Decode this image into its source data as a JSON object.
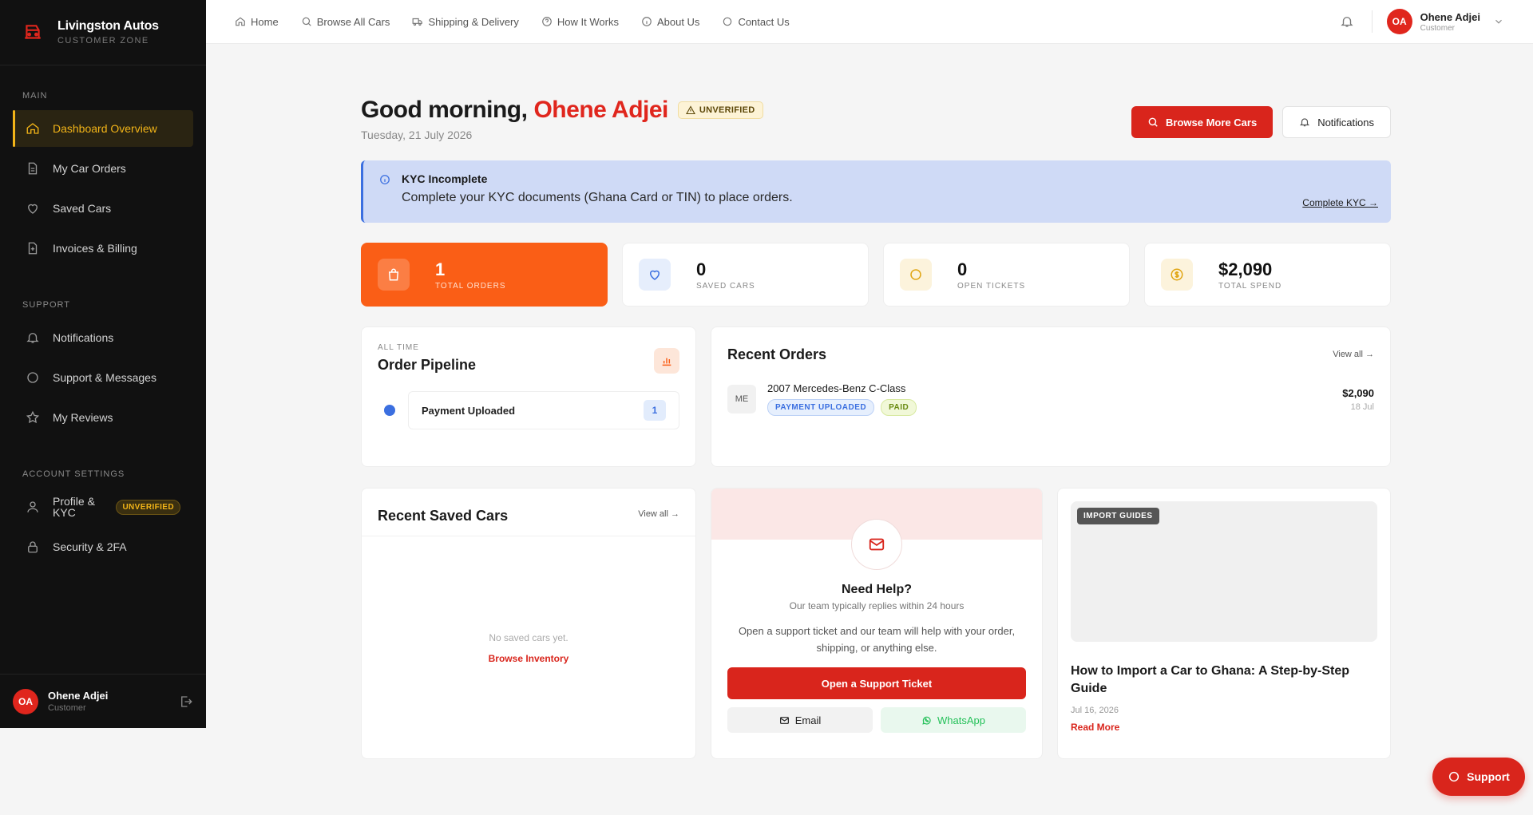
{
  "brand": {
    "name": "Livingston Autos",
    "sub": "CUSTOMER ZONE"
  },
  "sidebar": {
    "sections": [
      "MAIN",
      "SUPPORT",
      "ACCOUNT SETTINGS"
    ],
    "items": [
      {
        "label": "Dashboard Overview",
        "icon": "home-icon"
      },
      {
        "label": "My Car Orders",
        "icon": "document-icon"
      },
      {
        "label": "Saved Cars",
        "icon": "heart-icon"
      },
      {
        "label": "Invoices & Billing",
        "icon": "invoice-icon"
      },
      {
        "label": "Notifications",
        "icon": "bell-icon"
      },
      {
        "label": "Support & Messages",
        "icon": "chat-icon"
      },
      {
        "label": "My Reviews",
        "icon": "star-icon"
      },
      {
        "label": "Profile & KYC",
        "icon": "user-icon",
        "badge": "UNVERIFIED"
      },
      {
        "label": "Security & 2FA",
        "icon": "lock-icon"
      }
    ],
    "user": {
      "initials": "OA",
      "name": "Ohene Adjei",
      "role": "Customer"
    }
  },
  "topnav": {
    "links": [
      {
        "label": "Home",
        "icon": "home-icon"
      },
      {
        "label": "Browse All Cars",
        "icon": "search-icon"
      },
      {
        "label": "Shipping & Delivery",
        "icon": "truck-icon"
      },
      {
        "label": "How It Works",
        "icon": "help-icon"
      },
      {
        "label": "About Us",
        "icon": "info-icon"
      },
      {
        "label": "Contact Us",
        "icon": "chat-icon"
      }
    ],
    "user": {
      "initials": "OA",
      "name": "Ohene Adjei",
      "role": "Customer"
    }
  },
  "greeting": {
    "prefix": "Good morning,",
    "name": "Ohene Adjei",
    "badge": "UNVERIFIED",
    "date": "Tuesday, 21 July 2026",
    "browse_btn": "Browse More Cars",
    "notif_btn": "Notifications"
  },
  "kyc": {
    "title": "KYC Incomplete",
    "text": "Complete your KYC documents (Ghana Card or TIN) to place orders.",
    "link": "Complete KYC →"
  },
  "stats": [
    {
      "value": "1",
      "label": "TOTAL ORDERS",
      "icon": "bag-icon",
      "color": "#fa5e16"
    },
    {
      "value": "0",
      "label": "SAVED CARS",
      "icon": "heart-icon",
      "color": "#3b6fe0"
    },
    {
      "value": "0",
      "label": "OPEN TICKETS",
      "icon": "chat-icon",
      "color": "#e0a512"
    },
    {
      "value": "$2,090",
      "label": "TOTAL SPEND",
      "icon": "dollar-icon",
      "color": "#e0a512"
    }
  ],
  "pipeline": {
    "eyebrow": "ALL TIME",
    "title": "Order Pipeline",
    "rows": [
      {
        "label": "Payment Uploaded",
        "count": "1"
      }
    ]
  },
  "recent_orders": {
    "title": "Recent Orders",
    "view_all": "View all →",
    "items": [
      {
        "thumb": "ME",
        "name": "2007 Mercedes-Benz C-Class",
        "status": "PAYMENT UPLOADED",
        "payment": "PAID",
        "price": "$2,090",
        "date": "18 Jul"
      }
    ]
  },
  "saved_cars": {
    "title": "Recent Saved Cars",
    "view_all": "View all →",
    "empty": "No saved cars yet.",
    "link": "Browse Inventory"
  },
  "help": {
    "title": "Need Help?",
    "sub": "Our team typically replies within 24 hours",
    "desc": "Open a support ticket and our team will help with your order, shipping, or anything else.",
    "ticket_btn": "Open a Support Ticket",
    "email_btn": "Email",
    "whatsapp_btn": "WhatsApp"
  },
  "guide": {
    "tag": "IMPORT GUIDES",
    "title": "How to Import a Car to Ghana: A Step-by-Step Guide",
    "date": "Jul 16, 2026",
    "link": "Read More"
  },
  "fab": {
    "label": "Support"
  },
  "colors": {
    "accent": "#d9251c",
    "orange": "#fa5e16",
    "gold": "#f2b418",
    "blue": "#3b6fe0"
  }
}
